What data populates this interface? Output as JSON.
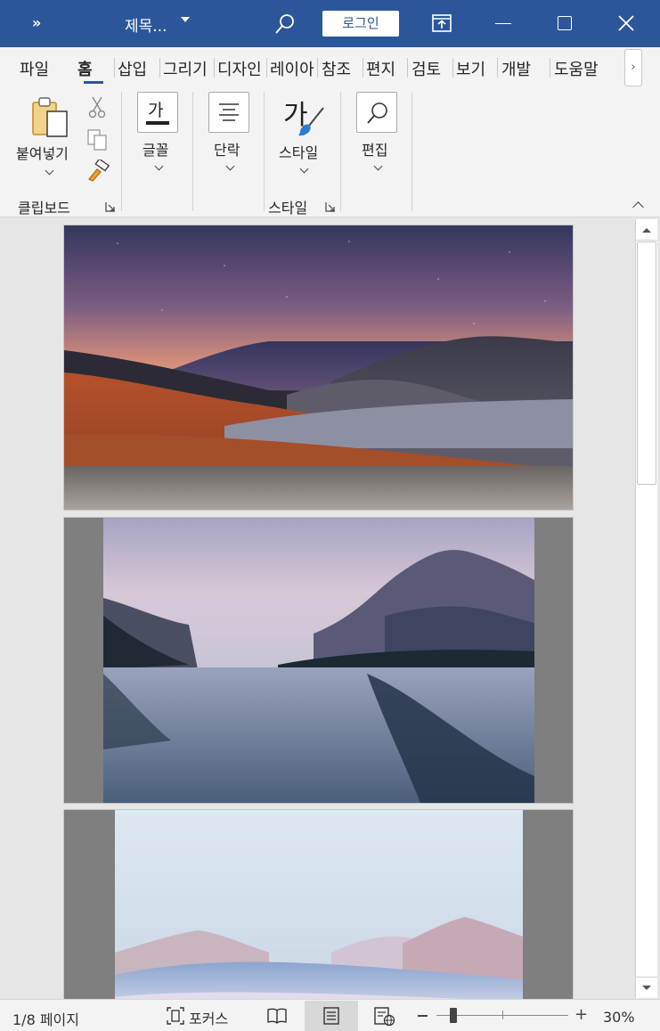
{
  "titlebar": {
    "chevrons": "»",
    "doc_title": "제목...",
    "login_label": "로그인"
  },
  "tabs": [
    {
      "label": "파일",
      "active": false
    },
    {
      "label": "홈",
      "active": true
    },
    {
      "label": "삽입",
      "active": false
    },
    {
      "label": "그리기",
      "active": false
    },
    {
      "label": "디자인",
      "active": false
    },
    {
      "label": "레이아",
      "active": false
    },
    {
      "label": "참조",
      "active": false
    },
    {
      "label": "편지",
      "active": false
    },
    {
      "label": "검토",
      "active": false
    },
    {
      "label": "보기",
      "active": false
    },
    {
      "label": "개발",
      "active": false
    },
    {
      "label": "도움말",
      "active": false
    }
  ],
  "tab_scroll_glyph": "›",
  "ribbon": {
    "clipboard": {
      "paste_label": "붙여넣기",
      "group_label": "클립보드"
    },
    "font": {
      "label": "글꼴",
      "icon_text": "가"
    },
    "paragraph": {
      "label": "단락"
    },
    "styles": {
      "label": "스타일",
      "group_label": "스타일",
      "icon_text": "가"
    },
    "editing": {
      "label": "편집"
    }
  },
  "document": {
    "pages": [
      {
        "image": "desert-dunes-dusk"
      },
      {
        "image": "misty-lake-mountains"
      },
      {
        "image": "snowy-mountain-dunes"
      }
    ]
  },
  "statusbar": {
    "page_info": "1/8 페이지",
    "focus_label": "포커스",
    "zoom_level_text": "30%",
    "zoom_percent": 30
  },
  "colors": {
    "accent": "#2b579a",
    "ribbon_bg": "#f3f3f3",
    "doc_bg": "#e6e6e6"
  }
}
